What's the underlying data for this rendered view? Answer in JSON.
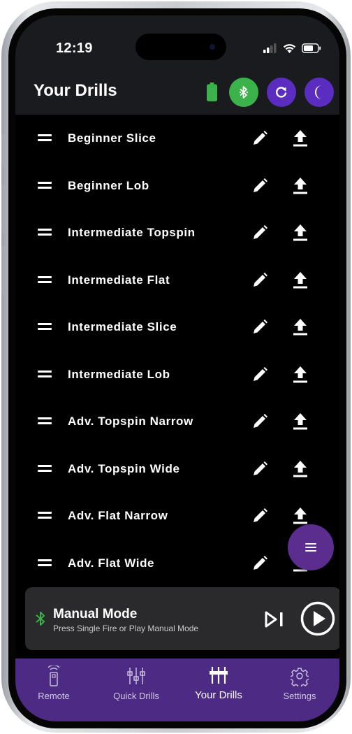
{
  "status_bar": {
    "time": "12:19"
  },
  "header": {
    "title": "Your Drills",
    "battery_color": "#3bb34a",
    "bluetooth_color": "#3bb34a",
    "accent_color": "#5a2cc0"
  },
  "drills": [
    {
      "name": "Beginner Slice"
    },
    {
      "name": "Beginner Lob"
    },
    {
      "name": "Intermediate Topspin"
    },
    {
      "name": "Intermediate Flat"
    },
    {
      "name": "Intermediate Slice"
    },
    {
      "name": "Intermediate Lob"
    },
    {
      "name": "Adv. Topspin Narrow"
    },
    {
      "name": "Adv. Topspin Wide"
    },
    {
      "name": "Adv. Flat Narrow"
    },
    {
      "name": "Adv. Flat Wide"
    }
  ],
  "row_icons": {
    "drag": "drag-handle-icon",
    "edit": "pencil-icon",
    "upload": "upload-icon"
  },
  "fab": {
    "icon": "menu-icon"
  },
  "manual_mode": {
    "title": "Manual Mode",
    "subtitle": "Press Single Fire or Play Manual Mode"
  },
  "tabs": [
    {
      "label": "Remote",
      "icon": "remote-icon",
      "active": false
    },
    {
      "label": "Quick Drills",
      "icon": "sliders-icon",
      "active": false
    },
    {
      "label": "Your Drills",
      "icon": "sliders-filled-icon",
      "active": true
    },
    {
      "label": "Settings",
      "icon": "gear-icon",
      "active": false
    }
  ],
  "tab_bar_color": "#4d2a84"
}
